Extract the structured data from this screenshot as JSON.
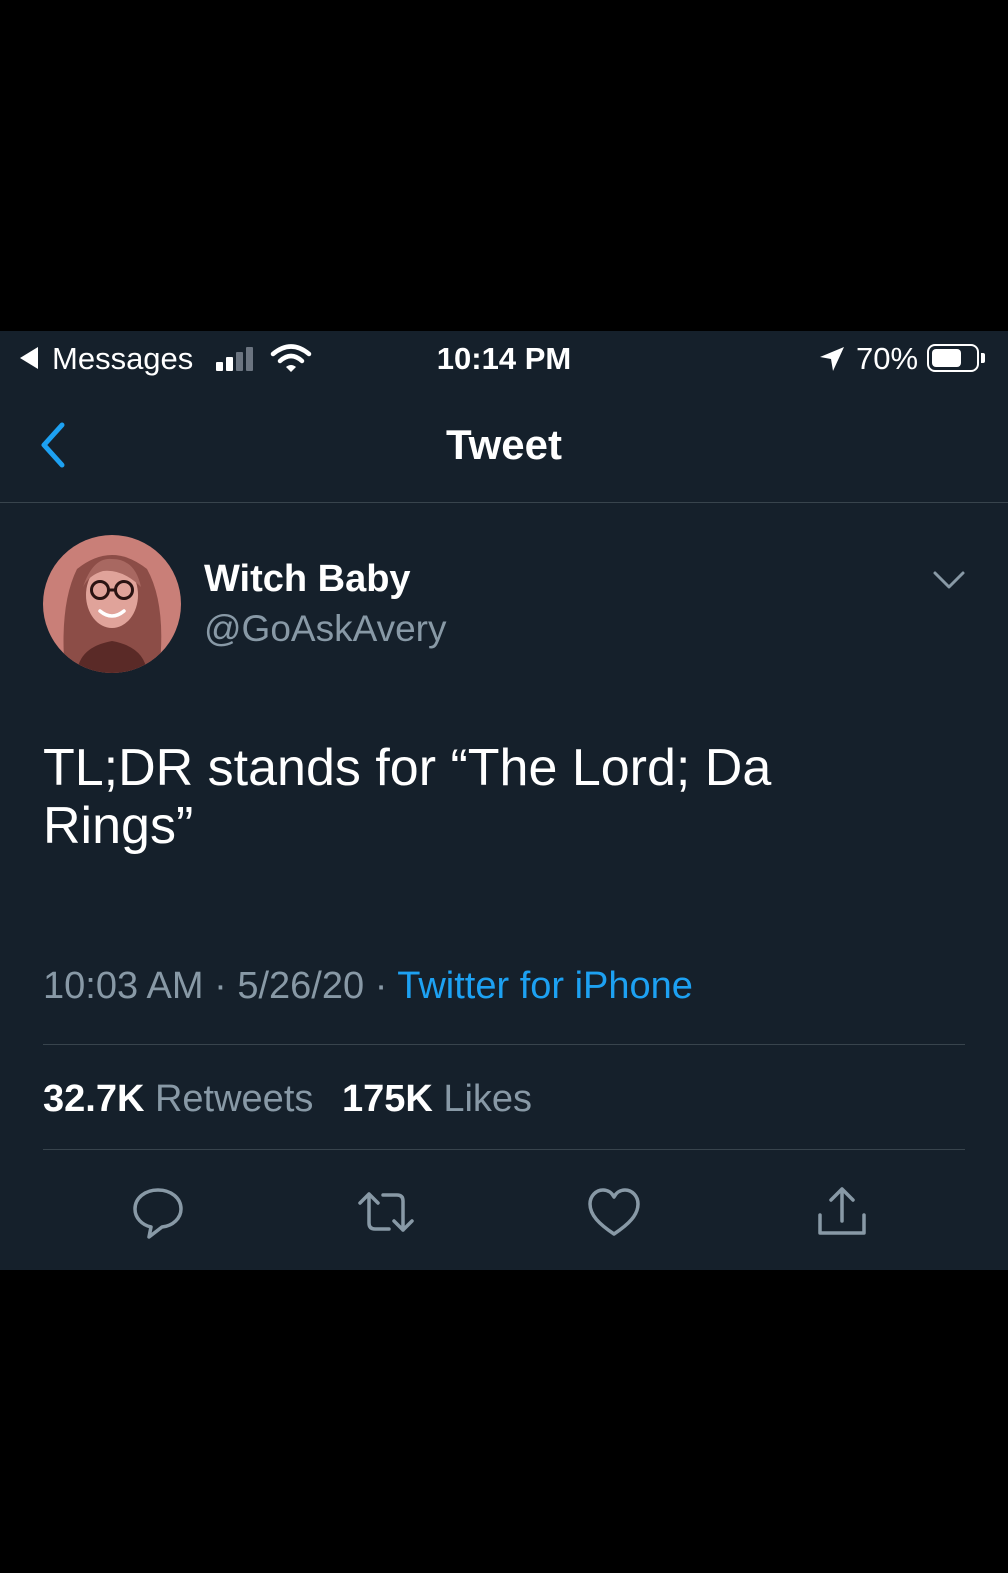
{
  "status_bar": {
    "back_app": "Messages",
    "time": "10:14 PM",
    "battery": "70%",
    "battery_level": 0.7,
    "signal_bars": 2
  },
  "nav": {
    "title": "Tweet",
    "back_icon": "chevron-left-icon"
  },
  "tweet": {
    "author_name": "Witch Baby",
    "author_handle": "@GoAskAvery",
    "text_lines": [
      "TL;DR stands for “The Lord; Da",
      "Rings”"
    ],
    "time": "10:03 AM",
    "separator": "·",
    "date": "5/26/20",
    "source": "Twitter for iPhone",
    "retweets_count": "32.7K",
    "retweets_label": "Retweets",
    "likes_count": "175K",
    "likes_label": "Likes"
  },
  "actions": [
    "reply-icon",
    "retweet-icon",
    "like-icon",
    "share-icon"
  ],
  "colors": {
    "background": "#15202b",
    "accent": "#1da1f2",
    "secondary_text": "#8899a6",
    "divider": "#38444d"
  }
}
